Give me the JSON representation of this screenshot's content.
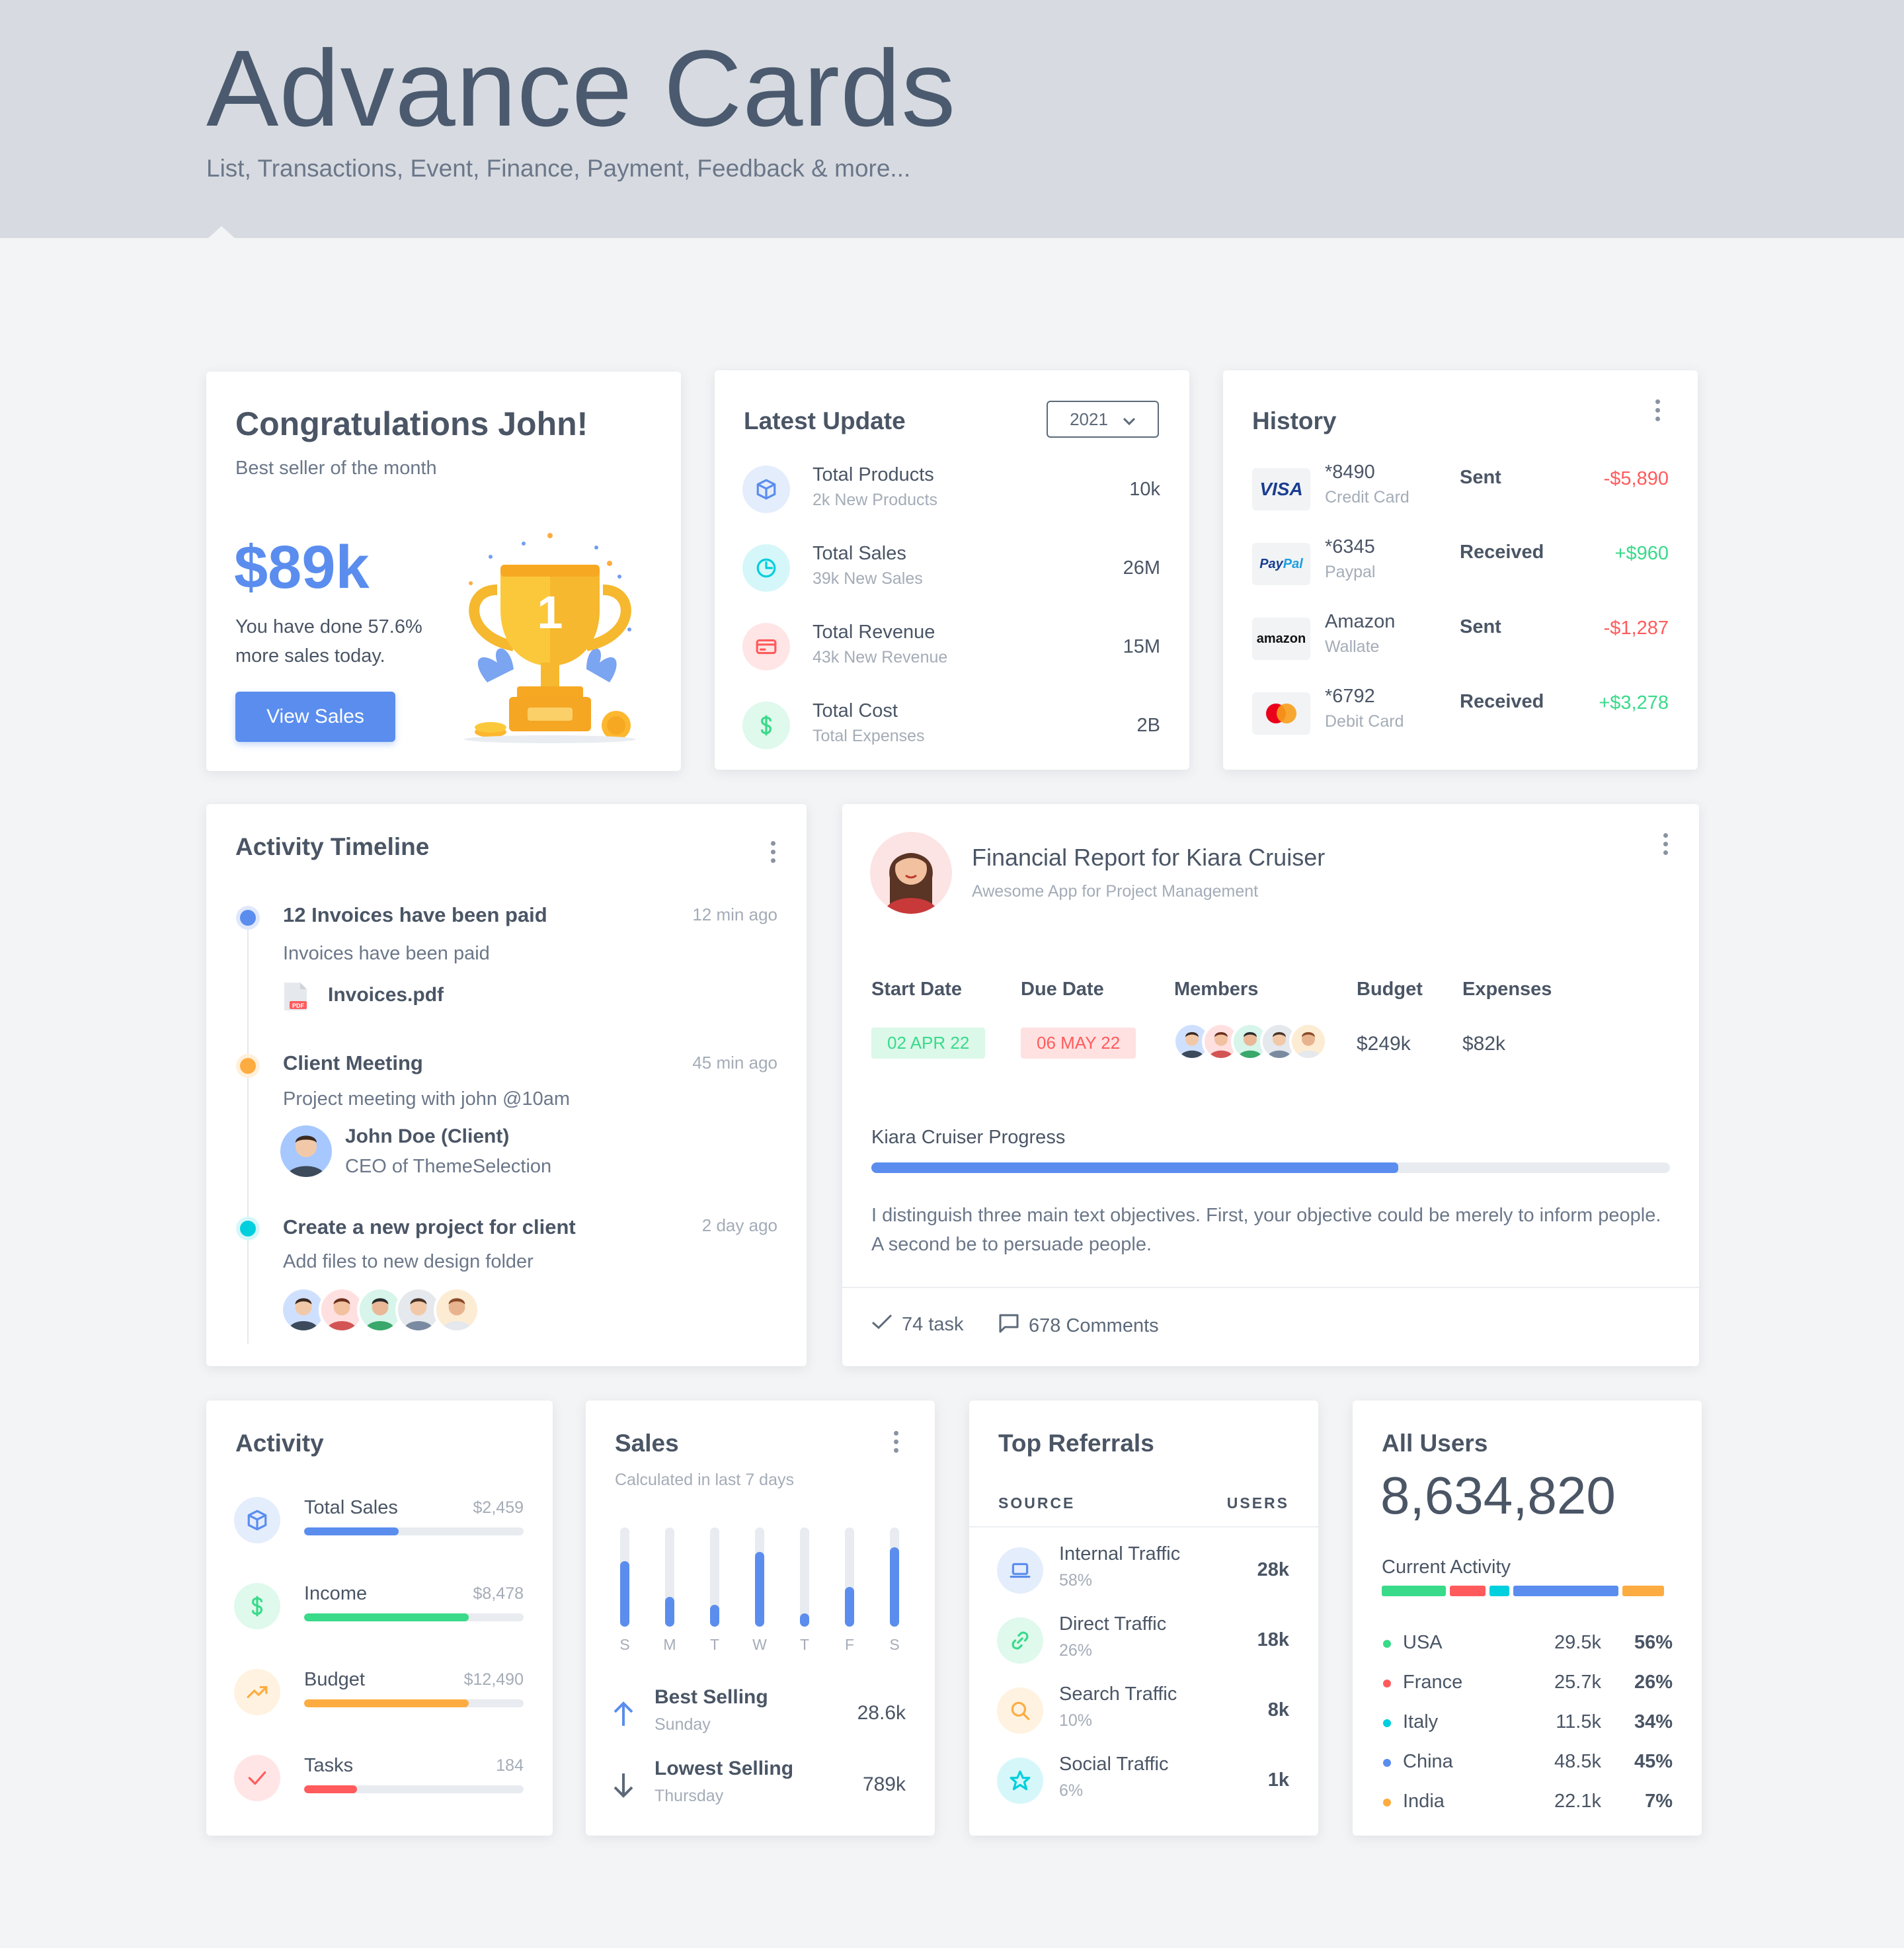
{
  "header": {
    "title": "Advance Cards",
    "subtitle": "List, Transactions, Event, Finance, Payment, Feedback & more..."
  },
  "congrats": {
    "title": "Congratulations John!",
    "subtitle": "Best seller of the month",
    "amount": "$89k",
    "desc_line1": "You have done 57.6%",
    "desc_line2": "more sales today.",
    "button": "View Sales",
    "trophy_number": "1"
  },
  "latest": {
    "title": "Latest Update",
    "year": "2021",
    "items": [
      {
        "label": "Total Products",
        "sub": "2k New Products",
        "value": "10k",
        "icon": "cube-icon",
        "color": "#5a8dee"
      },
      {
        "label": "Total Sales",
        "sub": "39k New Sales",
        "value": "26M",
        "icon": "pie-chart-icon",
        "color": "#00cfdd"
      },
      {
        "label": "Total Revenue",
        "sub": "43k New Revenue",
        "value": "15M",
        "icon": "credit-card-icon",
        "color": "#ff5b5c"
      },
      {
        "label": "Total Cost",
        "sub": "Total Expenses",
        "value": "2B",
        "icon": "dollar-icon",
        "color": "#39da8a"
      }
    ]
  },
  "history": {
    "title": "History",
    "items": [
      {
        "brand": "VISA",
        "num": "*8490",
        "type": "Credit Card",
        "status": "Sent",
        "amount": "-$5,890",
        "color": "#ff5b5c"
      },
      {
        "brand": "PayPal",
        "num": "*6345",
        "type": "Paypal",
        "status": "Received",
        "amount": "+$960",
        "color": "#39da8a"
      },
      {
        "brand": "amazon",
        "num": "Amazon",
        "type": "Wallate",
        "status": "Sent",
        "amount": "-$1,287",
        "color": "#ff5b5c"
      },
      {
        "brand": "MasterCard",
        "num": "*6792",
        "type": "Debit Card",
        "status": "Received",
        "amount": "+$3,278",
        "color": "#39da8a"
      }
    ]
  },
  "timeline": {
    "title": "Activity Timeline",
    "items": [
      {
        "title": "12 Invoices have been paid",
        "time": "12 min ago",
        "desc": "Invoices have been paid",
        "file": "Invoices.pdf",
        "file_badge": "PDF",
        "color": "#5a8dee"
      },
      {
        "title": "Client Meeting",
        "time": "45 min ago",
        "desc": "Project meeting with john @10am",
        "person": "John Doe (Client)",
        "role": "CEO of ThemeSelection",
        "color": "#fdac41"
      },
      {
        "title": "Create a new project for client",
        "time": "2 day ago",
        "desc": "Add files to new design folder",
        "color": "#00cfdd"
      }
    ]
  },
  "financial": {
    "title": "Financial Report for Kiara Cruiser",
    "subtitle": "Awesome App for Project Management",
    "headers": {
      "start": "Start Date",
      "due": "Due Date",
      "members": "Members",
      "budget": "Budget",
      "expenses": "Expenses"
    },
    "start": "02 APR 22",
    "due": "06 MAY 22",
    "budget": "$249k",
    "expenses": "$82k",
    "progress_label": "Kiara Cruiser Progress",
    "progress": 0.66,
    "body": "I distinguish three main text objectives. First, your objective could be merely to inform people. A second be to persuade people.",
    "tasks": "74 task",
    "comments": "678 Comments"
  },
  "activity": {
    "title": "Activity",
    "items": [
      {
        "label": "Total Sales",
        "value": "$2,459",
        "fill": 0.43,
        "color": "#5a8dee",
        "icon": "cube-icon"
      },
      {
        "label": "Income",
        "value": "$8,478",
        "fill": 0.75,
        "color": "#39da8a",
        "icon": "dollar-icon"
      },
      {
        "label": "Budget",
        "value": "$12,490",
        "fill": 0.75,
        "color": "#fdac41",
        "icon": "trending-up-icon"
      },
      {
        "label": "Tasks",
        "value": "184",
        "fill": 0.24,
        "color": "#ff5b5c",
        "icon": "check-icon"
      }
    ]
  },
  "sales": {
    "title": "Sales",
    "subtitle": "Calculated in last 7 days",
    "chart_data": {
      "type": "bar",
      "categories": [
        "S",
        "M",
        "T",
        "W",
        "T",
        "F",
        "S"
      ],
      "values": [
        0.66,
        0.3,
        0.22,
        0.75,
        0.13,
        0.4,
        0.8
      ],
      "ylim": [
        0,
        1
      ],
      "color": "#5a8dee",
      "track": "#e8ebef"
    },
    "best": {
      "label": "Best Selling",
      "day": "Sunday",
      "value": "28.6k"
    },
    "lowest": {
      "label": "Lowest Selling",
      "day": "Thursday",
      "value": "789k"
    }
  },
  "referrals": {
    "title": "Top Referrals",
    "col_source": "SOURCE",
    "col_users": "USERS",
    "items": [
      {
        "label": "Internal Traffic",
        "pct": "58%",
        "value": "28k",
        "color": "#5a8dee",
        "icon": "laptop-icon"
      },
      {
        "label": "Direct Traffic",
        "pct": "26%",
        "value": "18k",
        "color": "#39da8a",
        "icon": "link-icon"
      },
      {
        "label": "Search Traffic",
        "pct": "10%",
        "value": "8k",
        "color": "#fdac41",
        "icon": "search-icon"
      },
      {
        "label": "Social Traffic",
        "pct": "6%",
        "value": "1k",
        "color": "#00cfdd",
        "icon": "star-icon"
      }
    ]
  },
  "users": {
    "title": "All Users",
    "total": "8,634,820",
    "activity_label": "Current Activity",
    "segments": [
      {
        "color": "#39da8a",
        "w": 0.23
      },
      {
        "color": "#ff5b5c",
        "w": 0.13
      },
      {
        "color": "#00cfdd",
        "w": 0.07
      },
      {
        "color": "#5a8dee",
        "w": 0.38
      },
      {
        "color": "#fdac41",
        "w": 0.15
      }
    ],
    "items": [
      {
        "country": "USA",
        "value": "29.5k",
        "pct": "56%",
        "color": "#39da8a"
      },
      {
        "country": "France",
        "value": "25.7k",
        "pct": "26%",
        "color": "#ff5b5c"
      },
      {
        "country": "Italy",
        "value": "11.5k",
        "pct": "34%",
        "color": "#00cfdd"
      },
      {
        "country": "China",
        "value": "48.5k",
        "pct": "45%",
        "color": "#5a8dee"
      },
      {
        "country": "India",
        "value": "22.1k",
        "pct": "7%",
        "color": "#fdac41"
      }
    ]
  }
}
